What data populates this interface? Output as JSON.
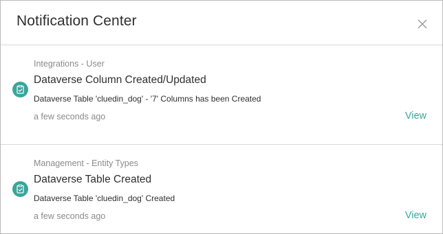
{
  "header": {
    "title": "Notification Center"
  },
  "colors": {
    "accent": "#3aa69b",
    "muted_text": "#8a8a8a",
    "primary_text": "#2e2e2e"
  },
  "notifications": [
    {
      "category": "Integrations - User",
      "title": "Dataverse Column Created/Updated",
      "message": "Dataverse Table 'cluedin_dog' - '7' Columns has been Created",
      "time": "a few seconds ago",
      "action_label": "View",
      "icon": "clipboard-check-icon"
    },
    {
      "category": "Management - Entity Types",
      "title": "Dataverse Table Created",
      "message": "Dataverse Table 'cluedin_dog' Created",
      "time": "a few seconds ago",
      "action_label": "View",
      "icon": "clipboard-check-icon"
    }
  ]
}
